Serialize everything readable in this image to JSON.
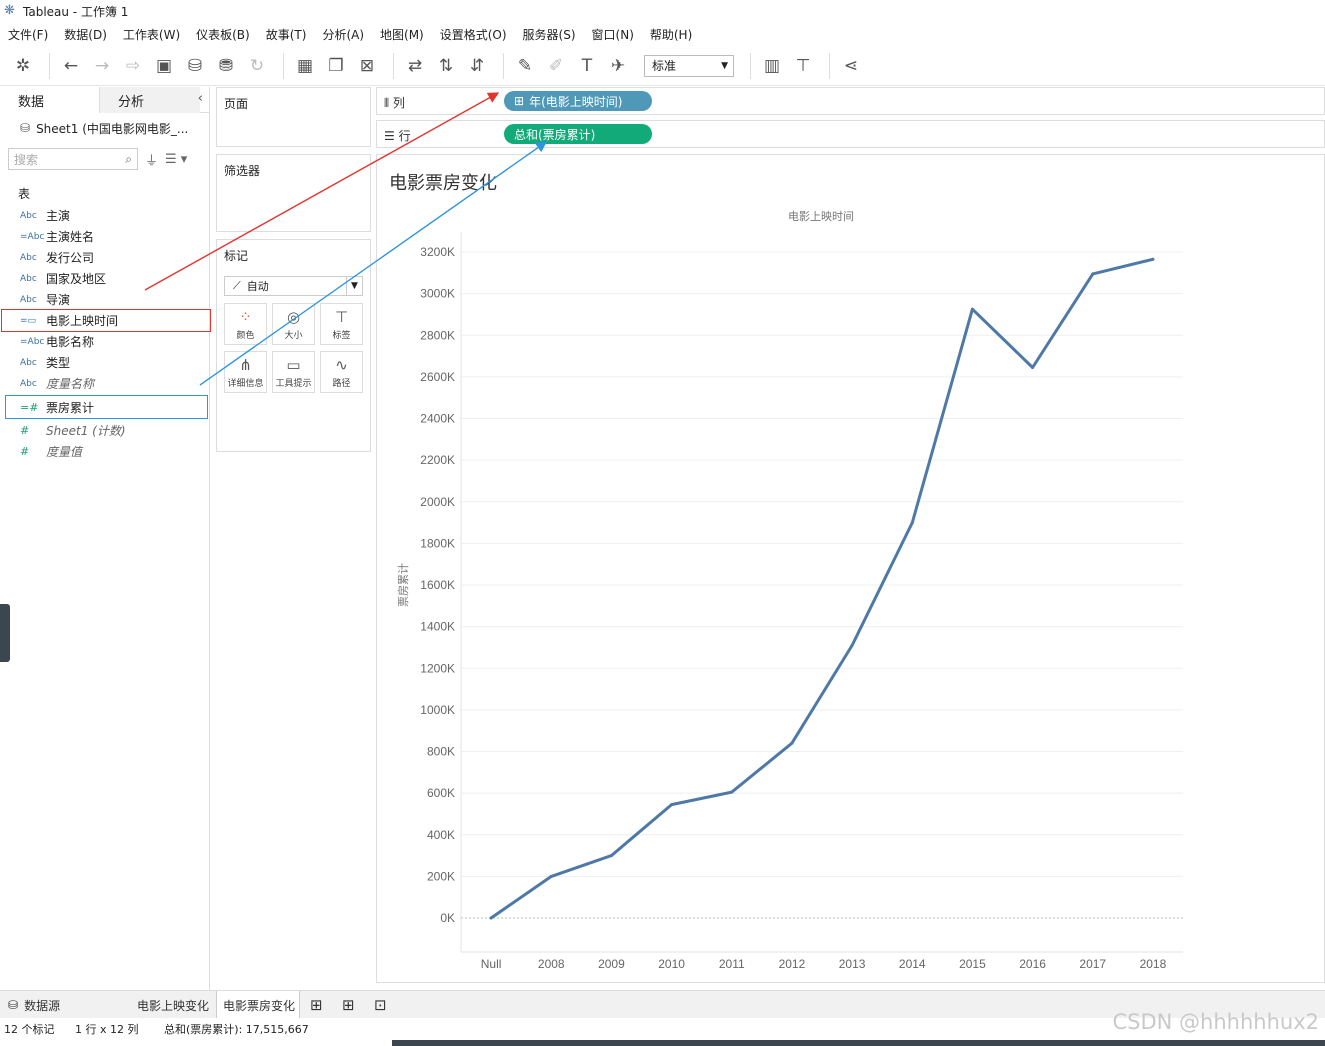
{
  "window": {
    "title": "Tableau - 工作簿 1"
  },
  "menu": [
    "文件(F)",
    "数据(D)",
    "工作表(W)",
    "仪表板(B)",
    "故事(T)",
    "分析(A)",
    "地图(M)",
    "设置格式(O)",
    "服务器(S)",
    "窗口(N)",
    "帮助(H)"
  ],
  "toolbar": {
    "fit_value": "标准"
  },
  "datapane": {
    "tab_data": "数据",
    "tab_analysis": "分析",
    "datasource": "Sheet1 (中国电影网电影_...",
    "search_placeholder": "搜索",
    "table_header": "表",
    "fields": [
      {
        "type": "Abc",
        "name": "主演",
        "kind": "dim"
      },
      {
        "type": "=Abc",
        "name": "主演姓名",
        "kind": "dim"
      },
      {
        "type": "Abc",
        "name": "发行公司",
        "kind": "dim"
      },
      {
        "type": "Abc",
        "name": "国家及地区",
        "kind": "dim"
      },
      {
        "type": "Abc",
        "name": "导演",
        "kind": "dim"
      },
      {
        "type": "=▭",
        "name": "电影上映时间",
        "kind": "dim"
      },
      {
        "type": "=Abc",
        "name": "电影名称",
        "kind": "dim"
      },
      {
        "type": "Abc",
        "name": "类型",
        "kind": "dim"
      },
      {
        "type": "Abc",
        "name": "度量名称",
        "kind": "dim-italic"
      },
      {
        "type": "=#",
        "name": "票房累计",
        "kind": "meas"
      },
      {
        "type": "#",
        "name": "Sheet1 (计数)",
        "kind": "meas-italic"
      },
      {
        "type": "#",
        "name": "度量值",
        "kind": "meas-italic"
      }
    ]
  },
  "cards": {
    "pages": "页面",
    "filters": "筛选器",
    "marks": "标记",
    "mark_type": "自动",
    "buttons": [
      "颜色",
      "大小",
      "标签",
      "详细信息",
      "工具提示",
      "路径"
    ]
  },
  "shelves": {
    "columns_label": "列",
    "rows_label": "行",
    "columns_pill": "年(电影上映时间)",
    "rows_pill": "总和(票房累计)"
  },
  "view": {
    "title": "电影票房变化"
  },
  "chart_data": {
    "type": "line",
    "title": "",
    "xlabel": "电影上映时间",
    "ylabel": "票房累计",
    "categories": [
      "Null",
      "2008",
      "2009",
      "2010",
      "2011",
      "2012",
      "2013",
      "2014",
      "2015",
      "2016",
      "2017",
      "2018"
    ],
    "series": [
      {
        "name": "",
        "color": "#4e79a7",
        "values": [
          0,
          200000,
          300000,
          545000,
          605000,
          840000,
          1310000,
          1900000,
          2925000,
          2645000,
          3095000,
          3165000
        ]
      }
    ],
    "yticks": [
      0,
      200000,
      400000,
      600000,
      800000,
      1000000,
      1200000,
      1400000,
      1600000,
      1800000,
      2000000,
      2200000,
      2400000,
      2600000,
      2800000,
      3000000,
      3200000
    ],
    "ytick_labels": [
      "0K",
      "200K",
      "400K",
      "600K",
      "800K",
      "1000K",
      "1200K",
      "1400K",
      "1600K",
      "1800K",
      "2000K",
      "2200K",
      "2400K",
      "2600K",
      "2800K",
      "3000K",
      "3200K"
    ],
    "ylim": [
      0,
      3200000
    ],
    "grid": true,
    "legend": "none"
  },
  "tabs": {
    "datasource": "数据源",
    "sheet1": "电影上映变化",
    "sheet2": "电影票房变化"
  },
  "status": {
    "marks": "12 个标记",
    "dims": "1 行 x 12 列",
    "sum": "总和(票房累计): 17,515,667"
  },
  "watermark": "CSDN @hhhhhhux2"
}
